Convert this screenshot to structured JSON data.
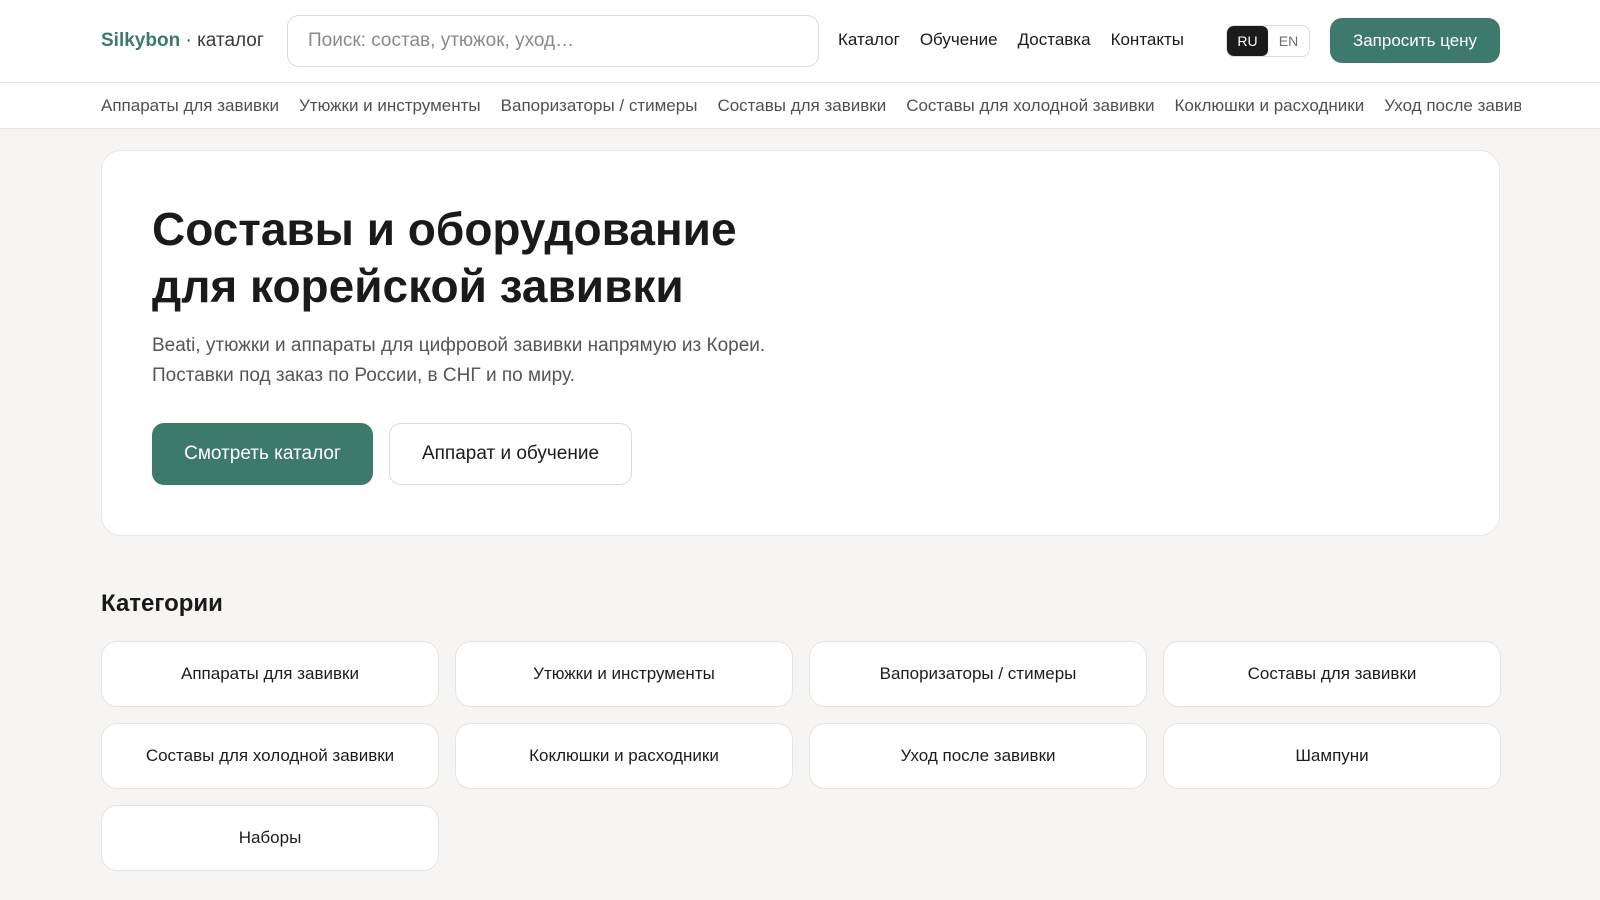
{
  "header": {
    "brand_name": "Silkybon",
    "brand_sub": " · каталог",
    "search_placeholder": "Поиск: состав, утюжок, уход…",
    "nav": [
      "Каталог",
      "Обучение",
      "Доставка",
      "Контакты"
    ],
    "lang_active": "RU",
    "lang_inactive": "EN",
    "cta_label": "Запросить цену"
  },
  "category_bar": [
    "Аппараты для завивки",
    "Утюжки и инструменты",
    "Вапоризаторы / стимеры",
    "Составы для завивки",
    "Составы для холодной завивки",
    "Коклюшки и расходники",
    "Уход после завивки"
  ],
  "hero": {
    "title_line1": "Составы и оборудование",
    "title_line2": "для корейской завивки",
    "description": "Beati, утюжки и аппараты для цифровой завивки напрямую из Кореи. Поставки под заказ по России, в СНГ и по миру.",
    "primary_button": "Смотреть каталог",
    "secondary_button": "Аппарат и обучение"
  },
  "categories": {
    "title": "Категории",
    "items": [
      "Аппараты для завивки",
      "Утюжки и инструменты",
      "Вапоризаторы / стимеры",
      "Составы для завивки",
      "Составы для холодной завивки",
      "Коклюшки и расходники",
      "Уход после завивки",
      "Шампуни",
      "Наборы"
    ]
  },
  "colors": {
    "accent": "#3d7a6c",
    "background": "#f6f5f3",
    "surface": "#ffffff"
  }
}
